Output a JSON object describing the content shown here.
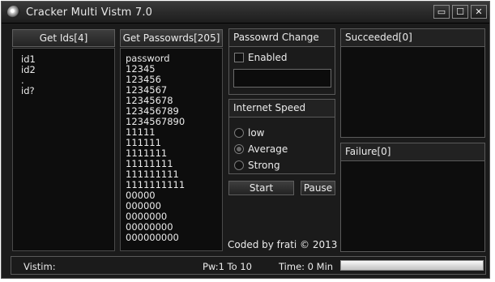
{
  "window": {
    "title": "Cracker Multi Vistm 7.0",
    "controls": {
      "minimize": "▭",
      "maximize": "☐",
      "close": "✕"
    }
  },
  "ids": {
    "button_label": "Get Ids[4]",
    "items": [
      "id1",
      "id2",
      ".",
      "id?"
    ]
  },
  "passwords": {
    "button_label": "Get Passowrds[205]",
    "items": [
      "password",
      "12345",
      "123456",
      "1234567",
      "12345678",
      "123456789",
      "1234567890",
      "11111",
      "111111",
      "1111111",
      "11111111",
      "111111111",
      "1111111111",
      "00000",
      "000000",
      "0000000",
      "00000000",
      "000000000"
    ]
  },
  "password_change": {
    "heading": "Passowrd Change",
    "enabled_label": "Enabled",
    "enabled_checked": false,
    "value": ""
  },
  "internet_speed": {
    "heading": "Internet Speed",
    "options": [
      "low",
      "Average",
      "Strong"
    ],
    "selected": "Average"
  },
  "actions": {
    "start": "Start",
    "pause": "Pause"
  },
  "credit": "Coded by frati ©  2013",
  "succeeded": {
    "heading": "Succeeded[0]"
  },
  "failure": {
    "heading": "Failure[0]"
  },
  "status": {
    "victim": "Vistim:",
    "pw_range": "Pw:1 To 10",
    "time": "Time: 0 Min",
    "progress": 0
  }
}
